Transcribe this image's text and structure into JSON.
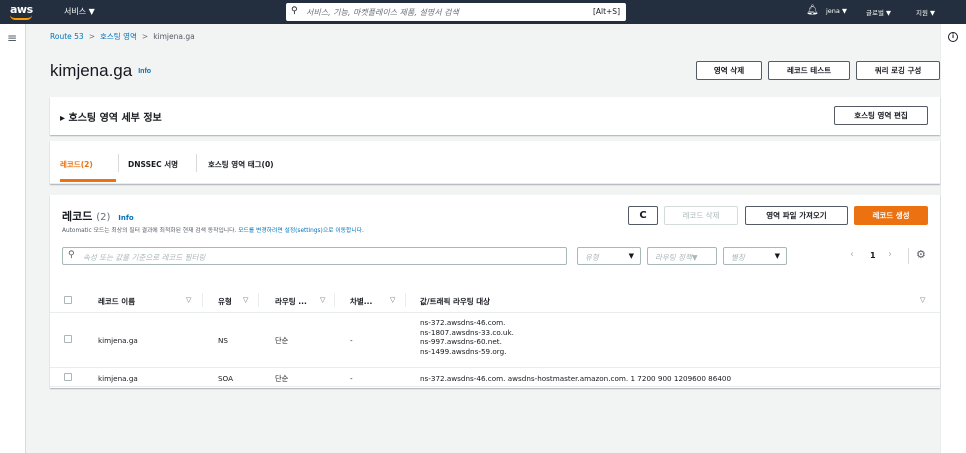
{
  "topnav": {
    "logo_text": "aws",
    "services": "서비스 ▼",
    "search_placeholder": "서비스, 기능, 마켓플레이스 제품, 설명서 검색",
    "search_shortcut": "[Alt+S]",
    "user": "jena ▼",
    "region": "글로벌 ▼",
    "support": "지원 ▼"
  },
  "breadcrumb": {
    "items": [
      "Route 53",
      "호스팅 영역",
      "kimjena.ga"
    ]
  },
  "page": {
    "title": "kimjena.ga",
    "info": "Info",
    "actions": {
      "delete_zone": "영역 삭제",
      "test_record": "레코드 테스트",
      "query_logging": "쿼리 로깅 구성"
    }
  },
  "details": {
    "label": "▸ 호스팅 영역 세부 정보",
    "edit": "호스팅 영역 편집"
  },
  "tabs": [
    {
      "label": "레코드(2)"
    },
    {
      "label": "DNSSEC 서명"
    },
    {
      "label": "호스팅 영역 태그(0)"
    }
  ],
  "records": {
    "title": "레코드",
    "count": "(2)",
    "info": "Info",
    "description": "Automatic 모드는 최상의 필터 결과에 최적화된 현재 검색 동작입니다.",
    "description_link": "모드를 변경하려면 설정(settings)으로 이동합니다.",
    "buttons": {
      "refresh": "C",
      "delete": "레코드 삭제",
      "import": "영역 파일 가져오기",
      "create": "레코드 생성"
    },
    "filter_placeholder": "속성 또는 값을 기준으로 레코드 필터링",
    "type_placeholder": "유형",
    "routing_placeholder": "라우팅 정책▼",
    "alias_placeholder": "별칭",
    "page": "1",
    "columns": [
      "레코드 이름",
      "유형",
      "라우팅 ...",
      "차별...",
      "값/트래픽 라우팅 대상"
    ],
    "rows": [
      {
        "name": "kimjena.ga",
        "type": "NS",
        "routing": "단순",
        "diff": "-",
        "value": [
          "ns-372.awsdns-46.com.",
          "ns-1807.awsdns-33.co.uk.",
          "ns-997.awsdns-60.net.",
          "ns-1499.awsdns-59.org."
        ]
      },
      {
        "name": "kimjena.ga",
        "type": "SOA",
        "routing": "단순",
        "diff": "-",
        "value": [
          "ns-372.awsdns-46.com. awsdns-hostmaster.amazon.com. 1 7200 900 1209600 86400"
        ]
      }
    ]
  }
}
